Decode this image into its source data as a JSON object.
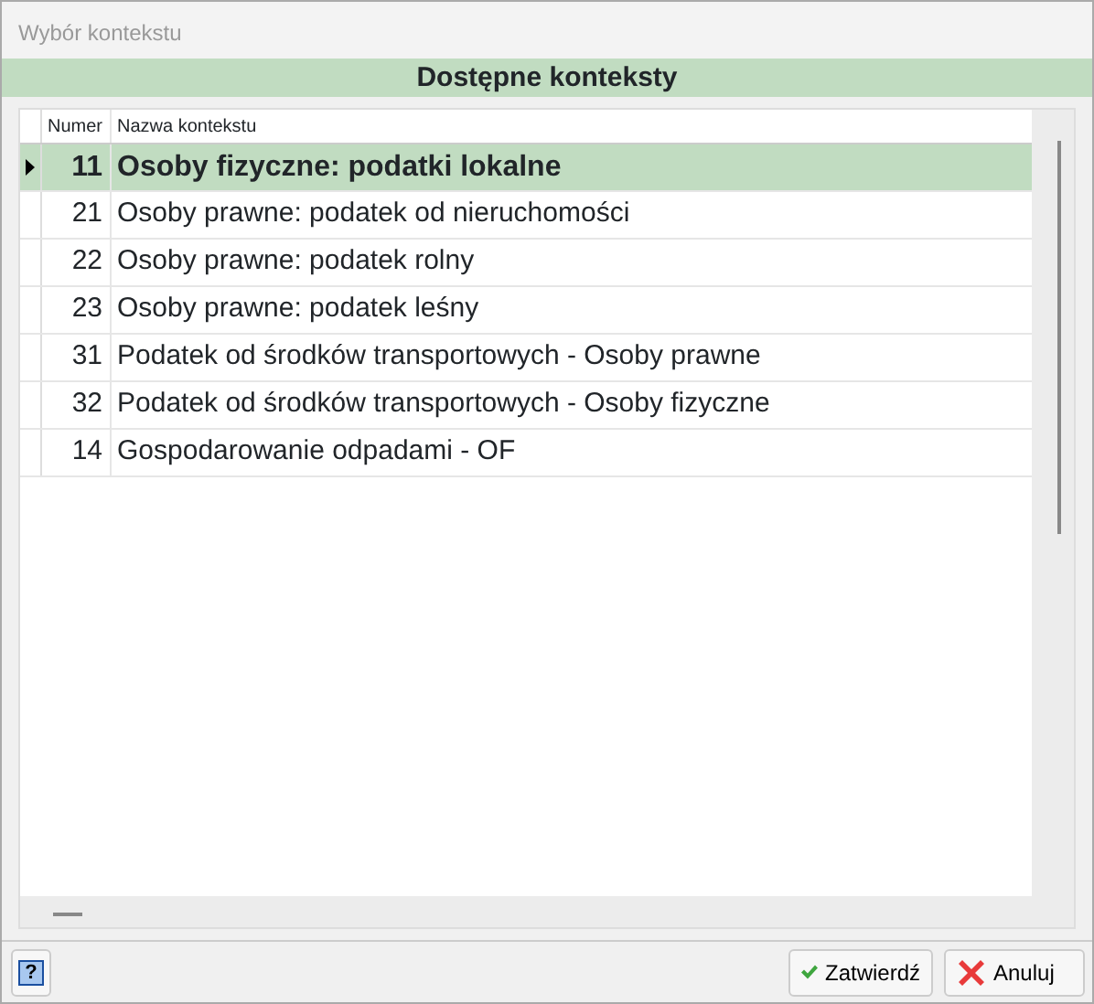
{
  "window": {
    "title": "Wybór kontekstu"
  },
  "header": "Dostępne konteksty",
  "table": {
    "columns": [
      "Numer",
      "Nazwa kontekstu"
    ],
    "rows": [
      {
        "numer": "11",
        "name": "Osoby fizyczne: podatki lokalne",
        "selected": true
      },
      {
        "numer": "21",
        "name": "Osoby prawne: podatek od nieruchomości",
        "selected": false
      },
      {
        "numer": "22",
        "name": "Osoby prawne: podatek rolny",
        "selected": false
      },
      {
        "numer": "23",
        "name": "Osoby prawne: podatek leśny",
        "selected": false
      },
      {
        "numer": "31",
        "name": "Podatek od środków transportowych - Osoby prawne",
        "selected": false
      },
      {
        "numer": "32",
        "name": "Podatek od środków transportowych - Osoby fizyczne",
        "selected": false
      },
      {
        "numer": "14",
        "name": "Gospodarowanie odpadami - OF",
        "selected": false
      }
    ]
  },
  "help_button": {
    "label": "?"
  },
  "buttons": [
    {
      "kind": "confirm",
      "label": "Zatwierdź"
    },
    {
      "kind": "cancel",
      "label": "Anuluj"
    }
  ]
}
